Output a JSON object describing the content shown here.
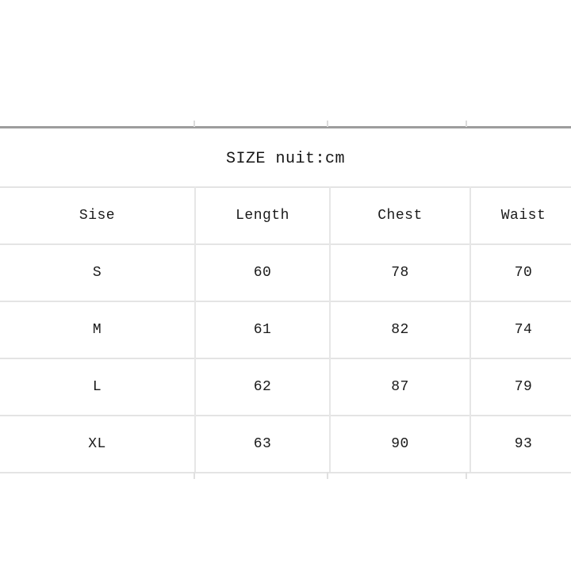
{
  "page": {
    "background_color": "#ffffff",
    "rule_color": "#9d9d9d",
    "border_color": "#e4e4e4",
    "text_color": "#1a1a1a"
  },
  "title": "SIZE nuit:cm",
  "table": {
    "headers": [
      "Sise",
      "Length",
      "Chest",
      "Waist"
    ],
    "rows": [
      [
        "S",
        "60",
        "78",
        "70"
      ],
      [
        "M",
        "61",
        "82",
        "74"
      ],
      [
        "L",
        "62",
        "87",
        "79"
      ],
      [
        "XL",
        "63",
        "90",
        "93"
      ]
    ]
  },
  "chart_data": {
    "type": "table",
    "title": "SIZE nuit:cm",
    "columns": [
      "Sise",
      "Length",
      "Chest",
      "Waist"
    ],
    "rows": [
      {
        "Sise": "S",
        "Length": 60,
        "Chest": 78,
        "Waist": 70
      },
      {
        "Sise": "M",
        "Length": 61,
        "Chest": 82,
        "Waist": 74
      },
      {
        "Sise": "L",
        "Length": 62,
        "Chest": 87,
        "Waist": 79
      },
      {
        "Sise": "XL",
        "Length": 63,
        "Chest": 90,
        "Waist": 93
      }
    ],
    "unit": "cm",
    "xlabel": "",
    "ylabel": ""
  }
}
